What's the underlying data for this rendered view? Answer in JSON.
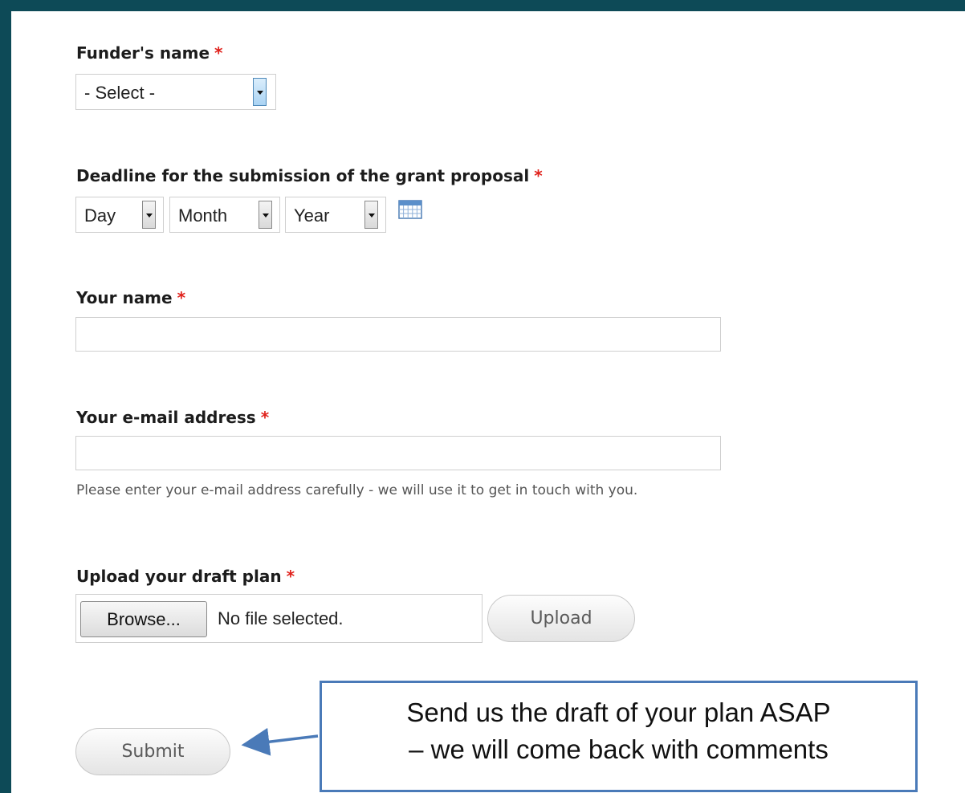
{
  "form": {
    "required_marker": "*",
    "funder": {
      "label": "Funder's name",
      "selected": "- Select -"
    },
    "deadline": {
      "label": "Deadline for the submission of the grant proposal",
      "day": "Day",
      "month": "Month",
      "year": "Year",
      "calendar_icon": "calendar-icon"
    },
    "name": {
      "label": "Your name",
      "value": ""
    },
    "email": {
      "label": "Your e-mail address",
      "value": "",
      "hint": "Please enter your e-mail address carefully - we will use it to get in touch with you."
    },
    "upload": {
      "label": "Upload your draft plan",
      "browse_label": "Browse...",
      "file_status": "No file selected.",
      "upload_button": "Upload"
    },
    "submit_label": "Submit"
  },
  "callout": {
    "line1": "Send us the draft of your plan ASAP",
    "line2": "– we will come back with comments"
  },
  "colors": {
    "background": "#0d4a57",
    "required": "#e0211b",
    "callout_border": "#4a7ab8"
  }
}
